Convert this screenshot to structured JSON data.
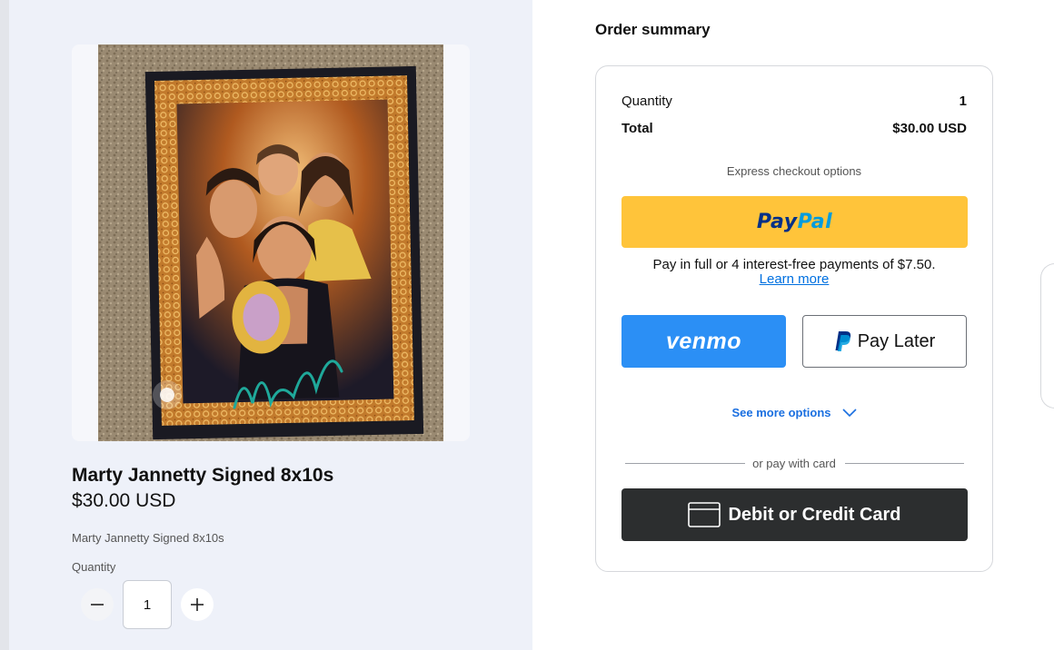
{
  "product": {
    "title": "Marty Jannetty Signed 8x10s",
    "price": "$30.00 USD",
    "description": "Marty Jannetty Signed 8x10s",
    "quantity_label": "Quantity",
    "quantity_value": "1",
    "signature_text": "Marty Jannetty"
  },
  "summary": {
    "heading": "Order summary",
    "quantity_label": "Quantity",
    "quantity_value": "1",
    "total_label": "Total",
    "total_value": "$30.00 USD",
    "express_label": "Express checkout options",
    "paypal_pay": "Pay",
    "paypal_pal": "Pal",
    "pay_in_4_text": "Pay in full or 4 interest-free payments of $7.50.",
    "learn_more": "Learn more",
    "venmo_label": "venmo",
    "pay_later_label": "Pay Later",
    "see_more_label": "See more options",
    "or_pay_with_card": "or pay with card",
    "card_button_label": "Debit or Credit Card"
  },
  "colors": {
    "paypal_yellow": "#ffc43a",
    "paypal_navy": "#003087",
    "paypal_blue": "#009cde",
    "venmo_blue": "#2b8ff5",
    "card_button_dark": "#2c2e2f",
    "link_blue": "#0070e0",
    "left_panel_bg": "#eef1f9"
  },
  "icons": {
    "minus": "minus-icon",
    "plus": "plus-icon",
    "paypal": "paypal-p-icon",
    "chevron": "chevron-down-icon",
    "card": "credit-card-icon"
  }
}
